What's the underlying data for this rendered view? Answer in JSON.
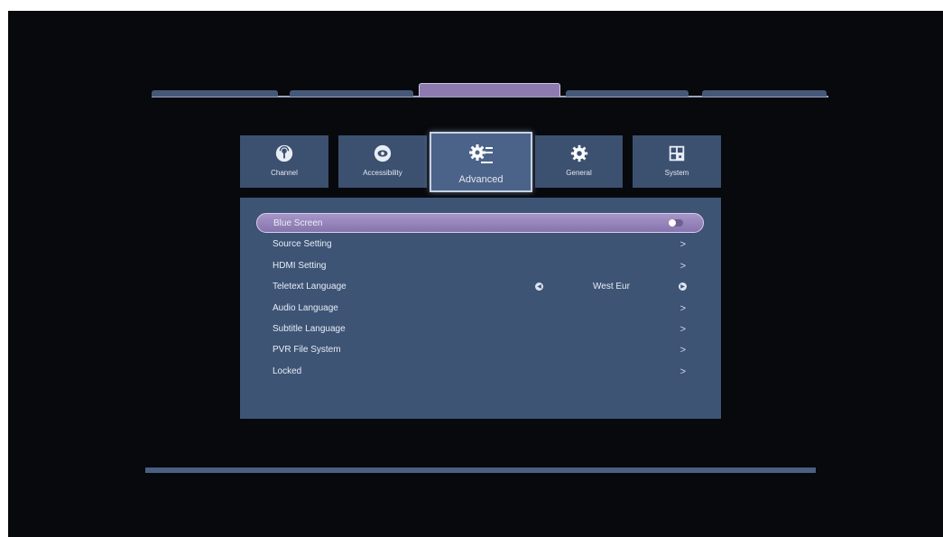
{
  "categories": [
    {
      "label": "Channel",
      "icon": "channel-icon"
    },
    {
      "label": "Accessibility",
      "icon": "eye-icon"
    },
    {
      "label": "Advanced",
      "icon": "advanced-settings-icon"
    },
    {
      "label": "General",
      "icon": "gear-icon"
    },
    {
      "label": "System",
      "icon": "system-grid-icon"
    }
  ],
  "active_category": "Advanced",
  "settings": [
    {
      "label": "Blue Screen",
      "control": "toggle",
      "state": "on",
      "selected": true
    },
    {
      "label": "Source Setting",
      "control": "submenu"
    },
    {
      "label": "HDMI Setting",
      "control": "submenu"
    },
    {
      "label": "Teletext Language",
      "control": "selector",
      "value": "West Eur"
    },
    {
      "label": "Audio Language",
      "control": "submenu"
    },
    {
      "label": "Subtitle Language",
      "control": "submenu"
    },
    {
      "label": "PVR File System",
      "control": "submenu"
    },
    {
      "label": "Locked",
      "control": "submenu"
    }
  ],
  "chevron_glyph": ">",
  "colors": {
    "background": "#07090d",
    "panel": "#3d5475",
    "tile": "#3c5070",
    "highlight": "#8d7bb0"
  }
}
